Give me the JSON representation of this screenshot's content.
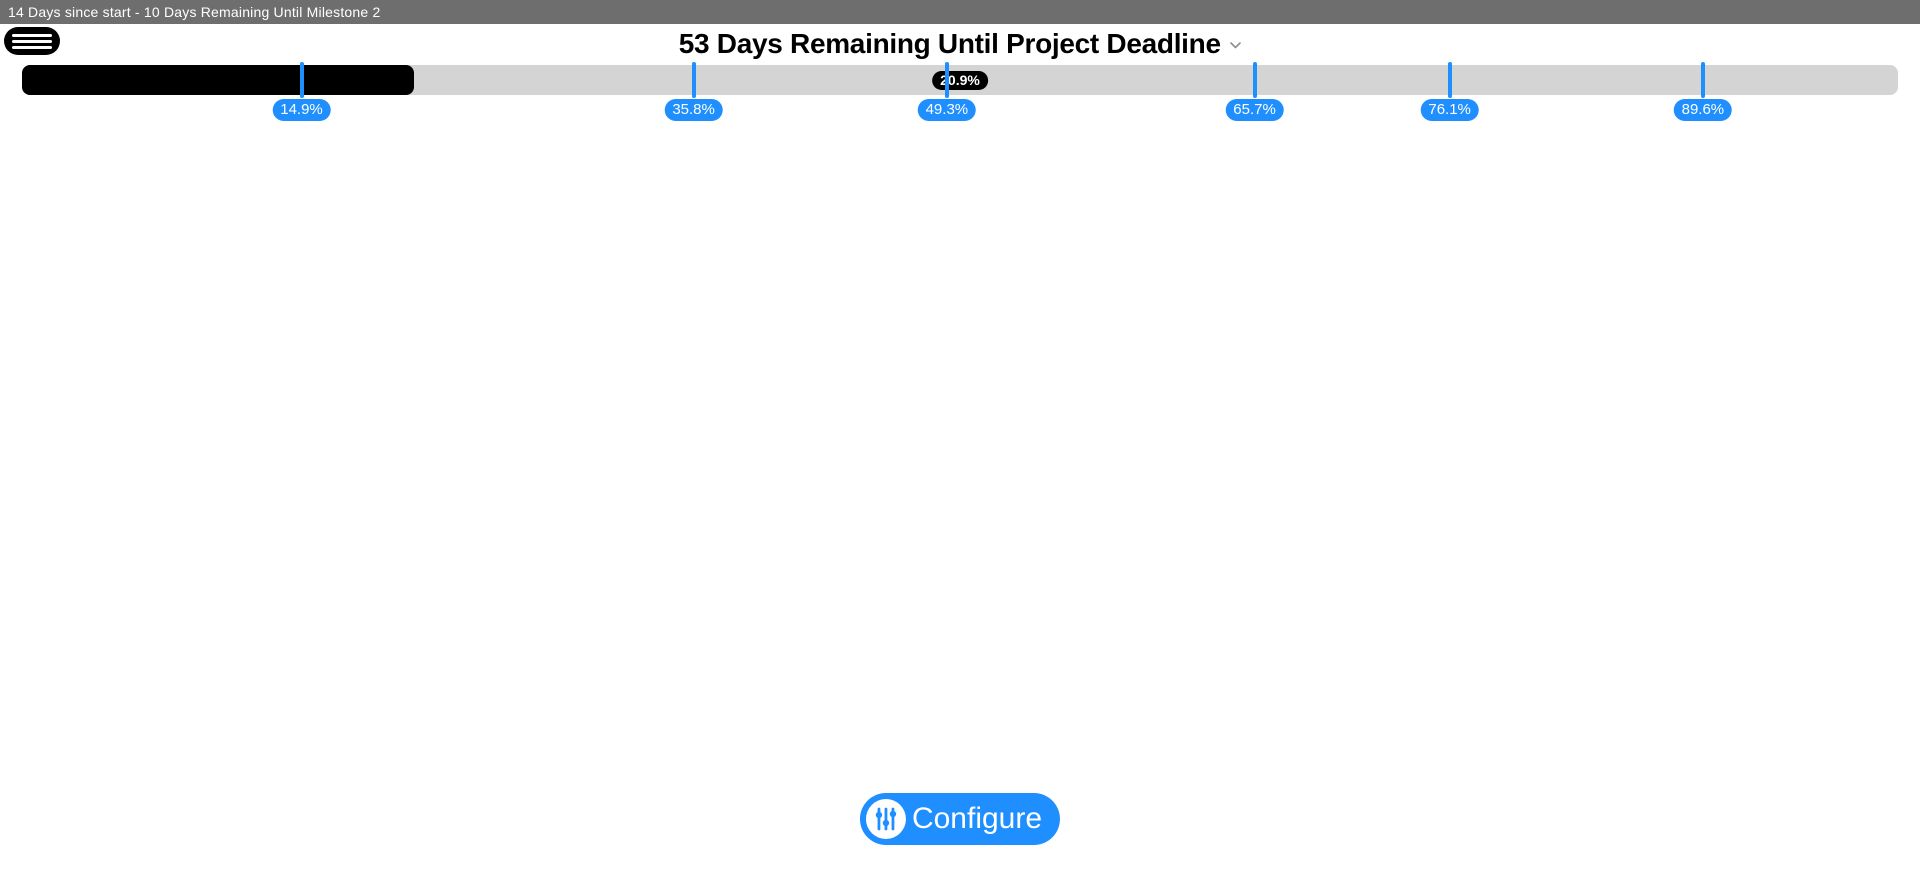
{
  "status_bar": {
    "text": "14 Days since start - 10 Days Remaining Until Milestone 2"
  },
  "headline": {
    "text": "53 Days Remaining Until Project Deadline"
  },
  "progress": {
    "percent": 20.9,
    "label": "20.9%",
    "bubble_position_pct": 50
  },
  "milestones": [
    {
      "percent": 14.9,
      "label": "14.9%"
    },
    {
      "percent": 35.8,
      "label": "35.8%"
    },
    {
      "percent": 49.3,
      "label": "49.3%"
    },
    {
      "percent": 65.7,
      "label": "65.7%"
    },
    {
      "percent": 76.1,
      "label": "76.1%"
    },
    {
      "percent": 89.6,
      "label": "89.6%"
    }
  ],
  "configure": {
    "label": "Configure"
  },
  "colors": {
    "accent": "#1f8fff",
    "track": "#d4d4d4",
    "fill": "#000000",
    "status_bg": "#6e6e6e"
  }
}
